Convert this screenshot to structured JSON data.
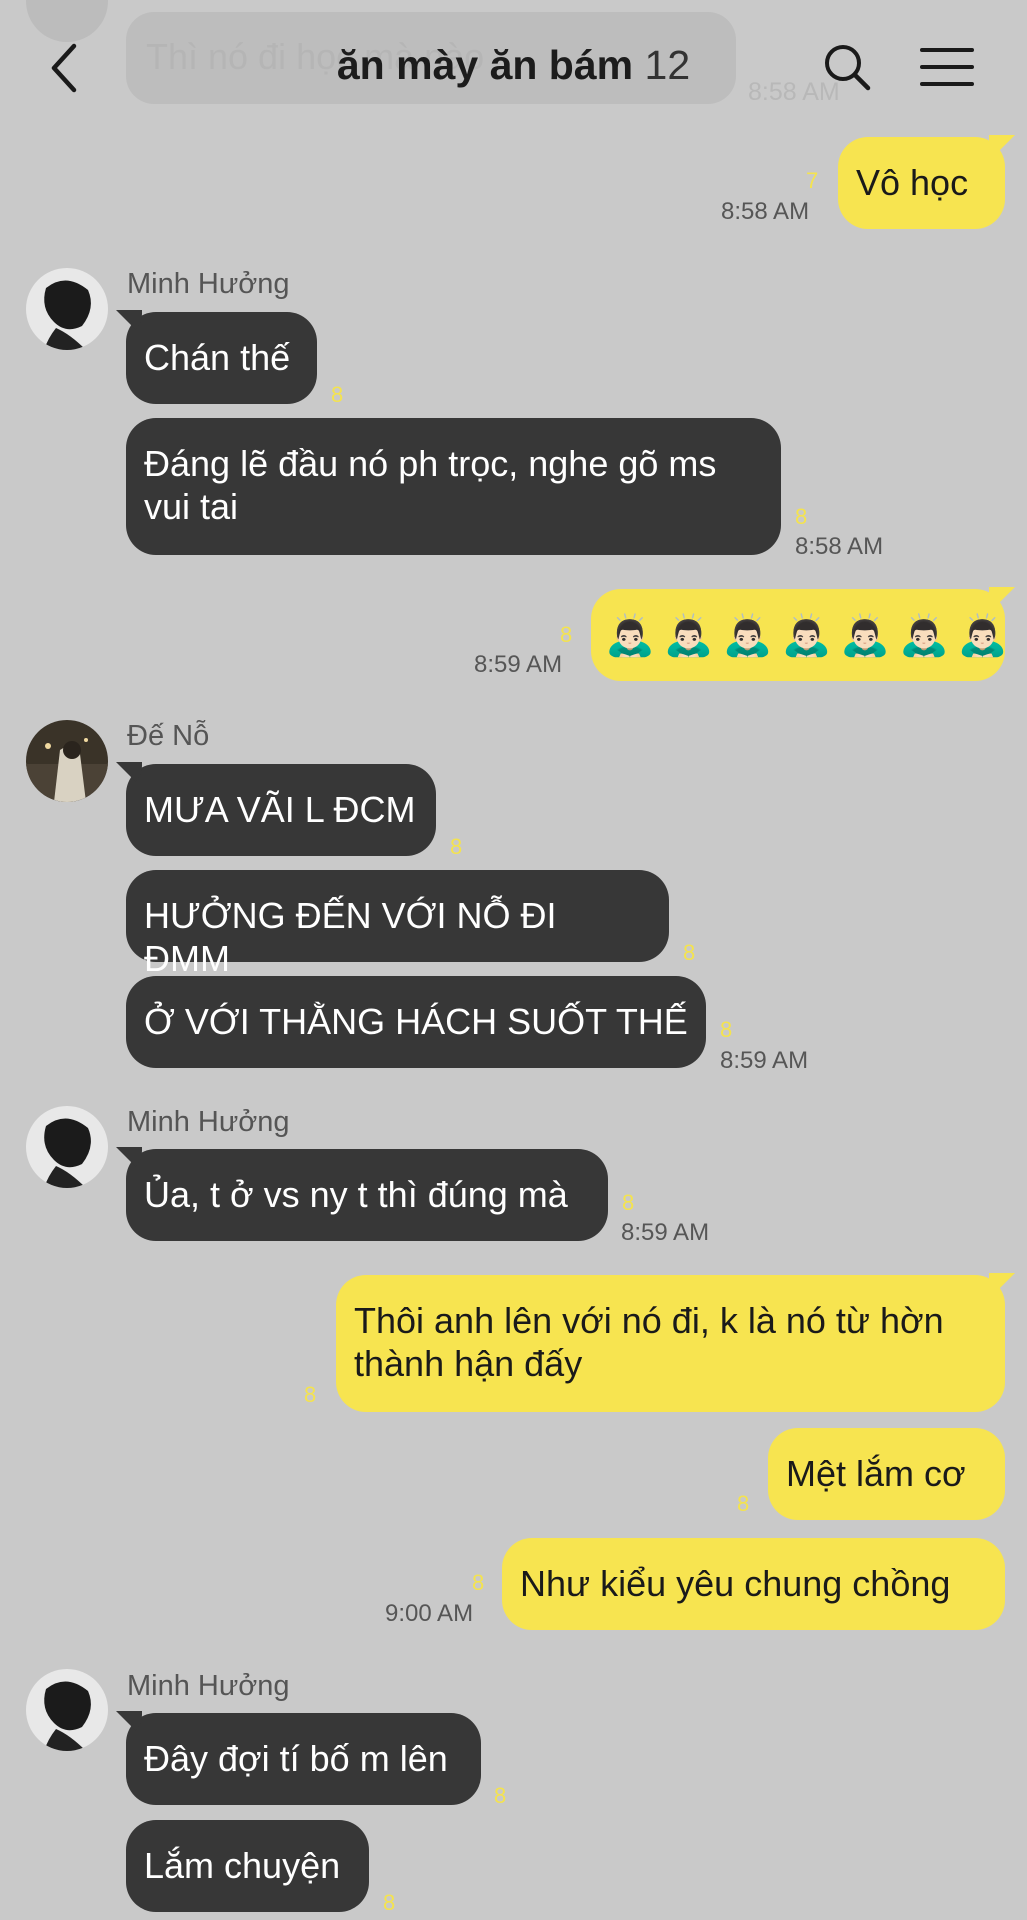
{
  "header": {
    "title": "ăn mày ăn bám",
    "member_count": "12",
    "back_icon": "chevron-left-icon",
    "search_icon": "search-icon",
    "menu_icon": "hamburger-menu-icon"
  },
  "faded": {
    "text": "Thì nó đi học mà nào",
    "time": "8:58 AM"
  },
  "messages": {
    "m1": {
      "text": "Vô học",
      "unread": "7",
      "time": "8:58 AM"
    },
    "s1": {
      "sender": "Minh Hưởng"
    },
    "m2": {
      "text": "Chán thế",
      "unread": "8"
    },
    "m3": {
      "text": "Đáng lẽ đầu nó ph trọc, nghe gõ ms vui tai",
      "unread": "8",
      "time": "8:58 AM"
    },
    "m4": {
      "unread": "8",
      "time": "8:59 AM",
      "emoji": "🙇🏻‍♂️",
      "emoji_count": 7
    },
    "s2": {
      "sender": "Đế Nỗ"
    },
    "m5": {
      "text": "MƯA VÃI L ĐCM",
      "unread": "8"
    },
    "m6": {
      "text": "HƯỞNG ĐẾN VỚI NỖ ĐI ĐMM",
      "unread": "8"
    },
    "m7": {
      "text": "Ở VỚI THẰNG HÁCH SUỐT THẾ",
      "unread": "8",
      "time": "8:59 AM"
    },
    "s3": {
      "sender": "Minh Hưởng"
    },
    "m8": {
      "text": "Ủa, t ở vs ny t thì đúng mà",
      "unread": "8",
      "time": "8:59 AM"
    },
    "m9": {
      "text": "Thôi anh lên với nó đi, k là nó từ hờn thành hận đấy",
      "unread": "8"
    },
    "m10": {
      "text": "Mệt lắm cơ",
      "unread": "8"
    },
    "m11": {
      "text": "Như kiểu yêu chung chồng",
      "unread": "8",
      "time": "9:00 AM"
    },
    "s4": {
      "sender": "Minh Hưởng"
    },
    "m12": {
      "text": "Đây đợi tí bố m lên",
      "unread": "8"
    },
    "m13": {
      "text": "Lắm chuyện",
      "unread": "8"
    }
  },
  "colors": {
    "background": "#c9c9c9",
    "incoming_bubble": "#373737",
    "outgoing_bubble": "#f7e450",
    "unread_count": "#f4e34f"
  }
}
